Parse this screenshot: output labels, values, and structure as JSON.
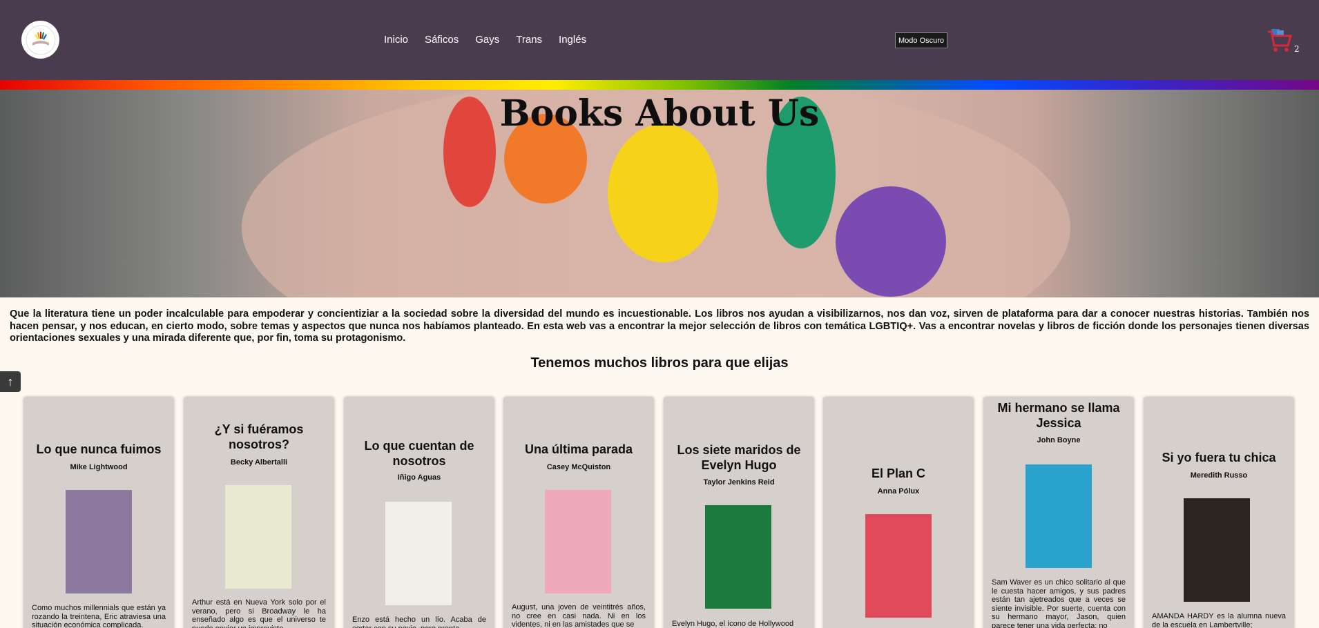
{
  "header": {
    "nav": [
      "Inicio",
      "Sáficos",
      "Gays",
      "Trans",
      "Inglés"
    ],
    "dark_mode_label": "Modo Oscuro",
    "cart_count": "2"
  },
  "hero": {
    "title": "Books About Us"
  },
  "intro": "Que la literatura tiene un poder incalculable para empoderar y concientiziar a la sociedad sobre la diversidad del mundo es incuestionable. Los libros nos ayudan a visibilizarnos, nos dan voz, sirven de plataforma para dar a conocer nuestras historias. También nos hacen pensar, y nos educan, en cierto modo, sobre temas y aspectos que nunca nos habíamos planteado. En esta web vas a encontrar la mejor selección de libros con temática LGBTIQ+. Vas a encontrar novelas y libros de ficción donde los personajes tienen diversas orientaciones sexuales y una mirada diferente que, por fin, toma su protagonismo.",
  "section_title": "Tenemos muchos libros para que elijas",
  "scroll_top_glyph": "↑",
  "books": [
    {
      "title": "Lo que nunca fuimos",
      "author": "Mike Lightwood",
      "desc": "Como muchos millennials que están ya rozando la treintena, Eric atraviesa una situación económica complicada.",
      "cover_color": "#8d7a9e"
    },
    {
      "title": "¿Y si fuéramos nosotros?",
      "author": "Becky Albertalli",
      "desc": "Arthur está en Nueva York solo por el verano, pero si Broadway le ha enseñado algo es que el universo te puede enviar un imprevisto",
      "cover_color": "#e8ead2"
    },
    {
      "title": "Lo que cuentan de nosotros",
      "author": "Iñigo Aguas",
      "desc": "Enzo está hecho un lío. Acaba de cortar con su novio, pero pronto",
      "cover_color": "#f2efea"
    },
    {
      "title": "Una última parada",
      "author": "Casey McQuiston",
      "desc": "August, una joven de veintitrés años, no cree en casi nada. Ni en los videntes, ni en las amistades que se",
      "cover_color": "#f0a9b8"
    },
    {
      "title": "Los siete maridos de Evelyn Hugo",
      "author": "Taylor Jenkins Reid",
      "desc": "Evelyn Hugo, el ícono de Hollywood",
      "cover_color": "#1d7a3e"
    },
    {
      "title": "El Plan C",
      "author": "Anna Pólux",
      "desc": "",
      "cover_color": "#e04a5a"
    },
    {
      "title": "Mi hermano se llama Jessica",
      "author": "John Boyne",
      "desc": "Sam Waver es un chico solitario al que le cuesta hacer amigos, y sus padres están tan ajetreados que a veces se siente invisible. Por suerte, cuenta con su hermano mayor, Jason, quien parece tener una vida perfecta: no",
      "cover_color": "#2aa3cf"
    },
    {
      "title": "Si yo fuera tu chica",
      "author": "Meredith Russo",
      "desc": "AMANDA HARDY es la alumna nueva de la escuela en Lambertville;",
      "cover_color": "#2b2522"
    }
  ]
}
